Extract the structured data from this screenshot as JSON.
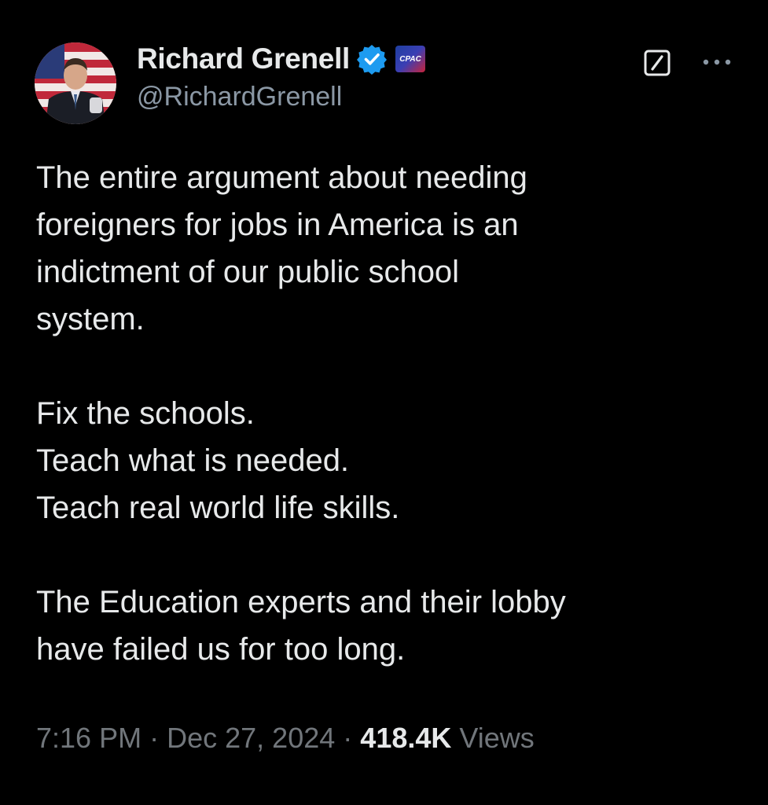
{
  "author": {
    "display_name": "Richard Grenell",
    "handle": "@RichardGrenell",
    "verified": true,
    "affiliate_badge_text": "CPAC"
  },
  "tweet": {
    "paragraphs": [
      [
        "The entire argument about needing",
        "foreigners for jobs in America is an",
        "indictment of our public school",
        "system."
      ],
      [
        "Fix the schools.",
        "Teach what is needed.",
        "Teach real world life skills."
      ],
      [
        "The Education experts and their lobby",
        "have failed us for too long."
      ]
    ],
    "time": "7:16 PM",
    "separator": "·",
    "date": "Dec 27, 2024",
    "views_count": "418.4K",
    "views_label": "Views"
  },
  "colors": {
    "background": "#000000",
    "text_primary": "#e7e9ea",
    "text_secondary": "#71767b",
    "verified_blue": "#1d9bf0"
  },
  "icons": {
    "verified": "verified-check-icon",
    "grok": "grok-icon",
    "more": "more-dots-icon"
  }
}
